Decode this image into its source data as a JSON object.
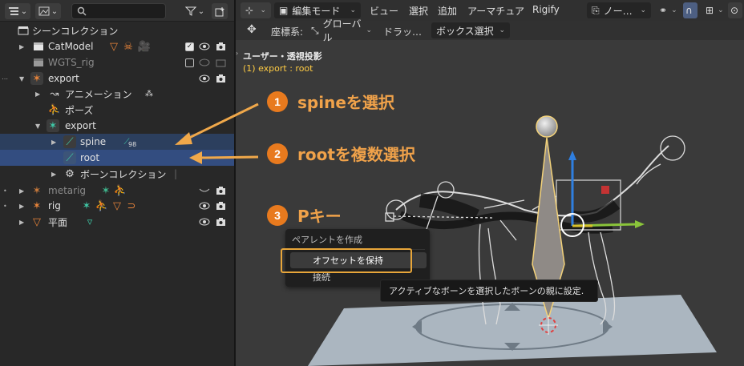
{
  "outliner": {
    "search_placeholder": "",
    "rows": [
      {
        "label": "シーンコレクション"
      },
      {
        "label": "CatModel"
      },
      {
        "label": "WGTS_rig"
      },
      {
        "label": "export"
      },
      {
        "label": "アニメーション"
      },
      {
        "label": "ポーズ"
      },
      {
        "label": "export"
      },
      {
        "label": "spine",
        "badge": "98"
      },
      {
        "label": "root"
      },
      {
        "label": "ボーンコレクション"
      },
      {
        "label": "metarig"
      },
      {
        "label": "rig"
      },
      {
        "label": "平面"
      }
    ]
  },
  "viewport": {
    "mode": "編集モード",
    "menus": [
      "ビュー",
      "選択",
      "追加",
      "アーマチュア",
      "Rigify"
    ],
    "view_dropdown": "ノー…",
    "coord_label": "座標系:",
    "coord_value": "グローバル",
    "drag_label": "ドラッ…",
    "box_select": "ボックス選択",
    "title": "ユーザー・透視投影",
    "subtitle": "(1) export : root"
  },
  "callouts": [
    {
      "num": "1",
      "text": "spineを選択"
    },
    {
      "num": "2",
      "text": "rootを複数選択"
    },
    {
      "num": "3",
      "text": "Pキー"
    }
  ],
  "popup": {
    "title": "ペアレントを作成",
    "items": [
      "オフセットを保持",
      "接続"
    ]
  },
  "tooltip": "アクティブなボーンを選択したボーンの親に設定.",
  "colors": {
    "accent_orange": "#e87a1e",
    "callout_text": "#f0a24a",
    "selection_blue": "#334d80",
    "highlight_box": "#e8a63a"
  }
}
